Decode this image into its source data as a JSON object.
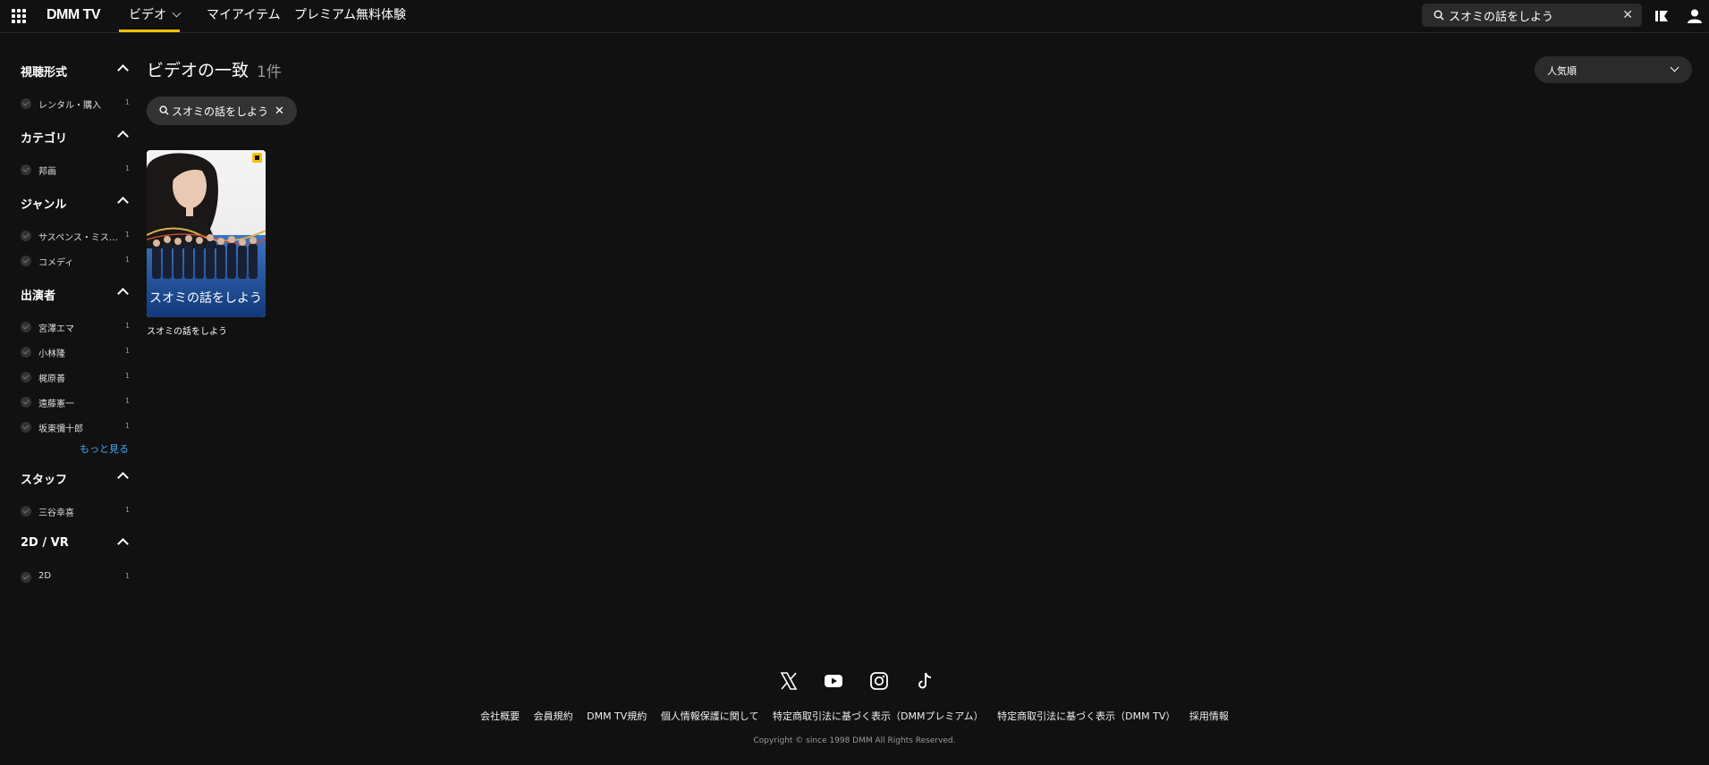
{
  "header": {
    "logo": "DMM TV",
    "tabs": [
      {
        "label": "ビデオ",
        "active": true
      },
      {
        "label": "マイアイテム",
        "active": false
      },
      {
        "label": "プレミアム無料体験",
        "active": false
      }
    ],
    "search": {
      "value": "スオミの話をしよう",
      "clear_symbol": "✕"
    }
  },
  "sidebar": {
    "sections": [
      {
        "title": "視聴形式",
        "items": [
          {
            "label": "レンタル・購入",
            "count": "1"
          }
        ]
      },
      {
        "title": "カテゴリ",
        "items": [
          {
            "label": "邦画",
            "count": "1"
          }
        ]
      },
      {
        "title": "ジャンル",
        "items": [
          {
            "label": "サスペンス・ミステリー",
            "count": "1"
          },
          {
            "label": "コメディ",
            "count": "1"
          }
        ]
      },
      {
        "title": "出演者",
        "items": [
          {
            "label": "宮澤エマ",
            "count": "1"
          },
          {
            "label": "小林隆",
            "count": "1"
          },
          {
            "label": "梶原善",
            "count": "1"
          },
          {
            "label": "遠藤憲一",
            "count": "1"
          },
          {
            "label": "坂東彌十郎",
            "count": "1"
          }
        ]
      },
      {
        "title": "スタッフ",
        "items": [
          {
            "label": "三谷幸喜",
            "count": "1"
          }
        ]
      },
      {
        "title": "2D / VR",
        "items": [
          {
            "label": "2D",
            "count": "1"
          }
        ]
      }
    ],
    "more_label": "もっと見る"
  },
  "main": {
    "title": "ビデオの一致",
    "count": "1件",
    "chip": {
      "label": "スオミの話をしよう",
      "close": "✕"
    },
    "sort": {
      "label": "人気順"
    },
    "results": [
      {
        "title": "スオミの話をしよう",
        "poster_text": "スオミの話をしよう"
      }
    ]
  },
  "footer": {
    "social": [
      "x-icon",
      "youtube-icon",
      "instagram-icon",
      "tiktok-icon"
    ],
    "links": [
      "会社概要",
      "会員規約",
      "DMM TV規約",
      "個人情報保護に関して",
      "特定商取引法に基づく表示（DMMプレミアム）",
      "特定商取引法に基づく表示（DMM TV）",
      "採用情報"
    ],
    "copyright": "Copyright © since 1998 DMM All Rights Reserved."
  },
  "colors": {
    "background": "#111111",
    "accent": "#f2c200",
    "link": "#3fa9f5",
    "panel": "#2b2b2b"
  }
}
